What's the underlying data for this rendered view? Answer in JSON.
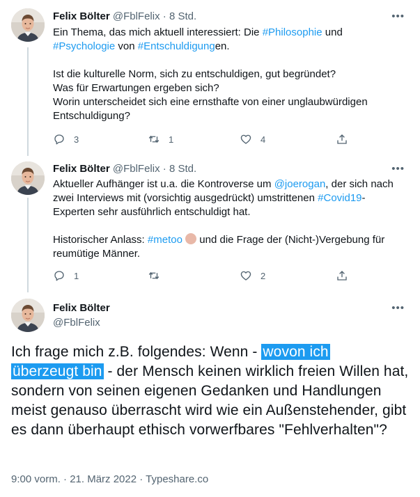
{
  "tweets": [
    {
      "name": "Felix Bölter",
      "handle": "@FblFelix",
      "dot": "·",
      "time": "8 Std.",
      "line1_pre": "Ein Thema, das mich aktuell interessiert: Die ",
      "line1_tag1": "#Philosophie",
      "line1_mid": " und",
      "line2_tag2": "#Psychologie",
      "line2_mid": " von ",
      "line2_tag3": "#Entschuldigung",
      "line2_post": "en.",
      "para2": [
        "Ist die kulturelle Norm, sich zu entschuldigen, gut begründet?",
        "Was für Erwartungen ergeben sich?",
        "Worin unterscheidet sich eine ernsthafte von einer unglaubwürdigen",
        "Entschuldigung?"
      ],
      "replies": "3",
      "retweets": "1",
      "likes": "4"
    },
    {
      "name": "Felix Bölter",
      "handle": "@FblFelix",
      "dot": "·",
      "time": "8 Std.",
      "l1_pre": "Aktueller Aufhänger ist u.a. die Kontroverse um ",
      "l1_mention": "@joerogan",
      "l1_post": ", der sich nach",
      "l2_pre": "zwei Interviews mit (vorsichtig ausgedrückt) umstrittenen ",
      "l2_tag": "#Covid19",
      "l2_post": "-",
      "l3": "Experten sehr ausführlich entschuldigt hat.",
      "l4_pre": "Historischer Anlass: ",
      "l4_tag": "#metoo",
      "l4_post": " und die Frage der (Nicht-)Vergebung für",
      "l5": "reumütige Männer.",
      "replies": "1",
      "retweets": "",
      "likes": "2"
    }
  ],
  "focus": {
    "name": "Felix Bölter",
    "handle": "@FblFelix",
    "text_pre": "Ich frage mich z.B. folgendes: Wenn - ",
    "text_highlight_1": "wovon ich",
    "text_highlight_2": "überzeugt bin",
    "text_post": " - der Mensch keinen wirklich freien Willen hat, sondern von seinen eigenen Gedanken und Handlungen meist genauso überrascht wird wie ein Außenstehender, gibt es dann überhaupt ethisch vorwerfbares \"Fehlverhalten\"?",
    "timestamp": "9:00 vorm. · 21. März 2022 · Typeshare.co"
  },
  "icons": {
    "reply": "reply-icon",
    "retweet": "retweet-icon",
    "like": "heart-icon",
    "share": "share-icon",
    "more": "more-icon"
  },
  "colors": {
    "link": "#1d9bf0",
    "muted": "#536471",
    "highlight": "#1d9bf0"
  }
}
